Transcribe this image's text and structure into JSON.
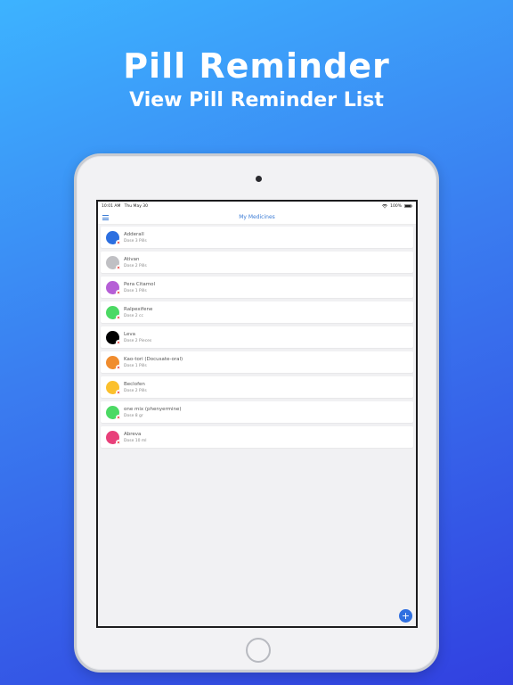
{
  "marketing": {
    "title": "Pill Reminder",
    "subtitle": "View Pill Reminder List"
  },
  "statusbar": {
    "time": "10:01 AM",
    "date": "Thu May 30",
    "wifi": "wifi-icon",
    "battery": "100%"
  },
  "navbar": {
    "title": "My Medicines",
    "menu_icon": "hamburger-icon"
  },
  "medicines": [
    {
      "name": "Adderall",
      "dose": "Dose 3 Pills",
      "color": "#2c6fe0"
    },
    {
      "name": "Ativan",
      "dose": "Dose 2 Pills",
      "color": "#c0c0c4"
    },
    {
      "name": "Pera Citamol",
      "dose": "Dose 1 Pills",
      "color": "#b55fd6"
    },
    {
      "name": "Ralpexifene",
      "dose": "Dose 2 cc",
      "color": "#4cd964"
    },
    {
      "name": "Leva",
      "dose": "Dose 2 Pieces",
      "color": "#000000"
    },
    {
      "name": "Kao-tori (Docusate-oral)",
      "dose": "Dose 1 Pills",
      "color": "#f08c2e"
    },
    {
      "name": "Beclofen",
      "dose": "Dose 2 Pills",
      "color": "#fbc02d"
    },
    {
      "name": "one mix (phenyermine)",
      "dose": "Dose 8 gr",
      "color": "#4cd964"
    },
    {
      "name": "Abreva",
      "dose": "Dose 10 ml",
      "color": "#e8407a"
    }
  ],
  "fab": {
    "label": "+"
  }
}
